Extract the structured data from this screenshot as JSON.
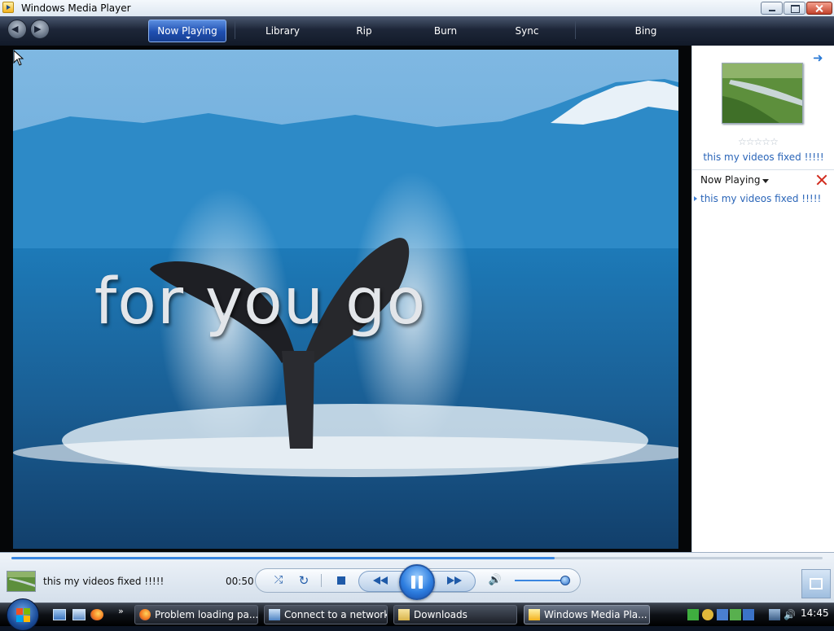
{
  "window": {
    "title": "Windows Media Player"
  },
  "nav": {
    "tabs": [
      {
        "label": "Now Playing"
      },
      {
        "label": "Library"
      },
      {
        "label": "Rip"
      },
      {
        "label": "Burn"
      },
      {
        "label": "Sync"
      },
      {
        "label": "Bing"
      }
    ],
    "back_icon": "back-arrow-icon",
    "forward_icon": "forward-arrow-icon"
  },
  "video": {
    "lyric_text": "for you go"
  },
  "panel": {
    "media_title": "this my videos fixed !!!!!",
    "rating_stars": 0,
    "rating_max": 5,
    "list_label": "Now Playing",
    "playlist": [
      "this my videos fixed !!!!!"
    ]
  },
  "controls": {
    "now_playing_title": "this my videos fixed !!!!!",
    "time": "00:50",
    "seek_progress": 0.67,
    "volume_level": 0.9,
    "state": "playing"
  },
  "taskbar": {
    "tasks": [
      {
        "label": "Problem loading pa..."
      },
      {
        "label": "Connect to a network"
      },
      {
        "label": "Downloads"
      },
      {
        "label": "Windows Media Pla..."
      }
    ],
    "clock": "14:45"
  },
  "colors": {
    "accent": "#1f5aa8",
    "link": "#2a65b8",
    "clear_x": "#d12b1e"
  }
}
